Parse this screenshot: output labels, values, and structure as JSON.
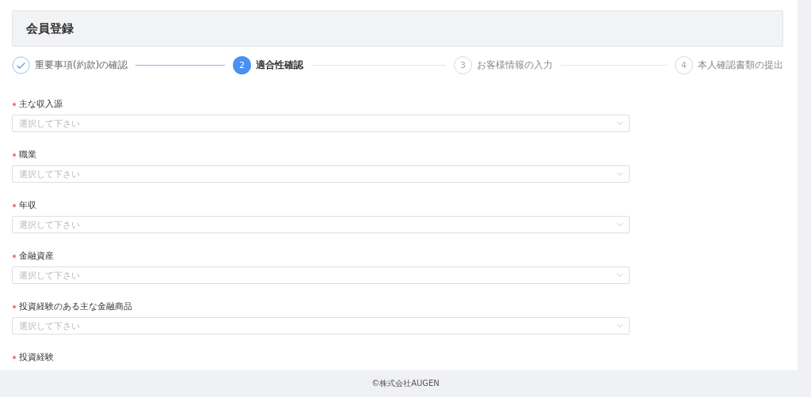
{
  "header": {
    "title": "会員登録"
  },
  "steps": [
    {
      "label": "重要事項(約款)の確認",
      "completed": true,
      "selected": false
    },
    {
      "number": "2",
      "label": "適合性確認",
      "completed": false,
      "selected": true
    },
    {
      "number": "3",
      "label": "お客様情報の入力",
      "completed": false,
      "selected": false
    },
    {
      "number": "4",
      "label": "本人確認書類の提出",
      "completed": false,
      "selected": false
    }
  ],
  "fields": [
    {
      "label": "主な収入源",
      "required": true,
      "placeholder": "選択して下さい"
    },
    {
      "label": "職業",
      "required": true,
      "placeholder": "選択して下さい"
    },
    {
      "label": "年収",
      "required": true,
      "placeholder": "選択して下さい"
    },
    {
      "label": "金融資産",
      "required": true,
      "placeholder": "選択して下さい"
    },
    {
      "label": "投資経験のある主な金融商品",
      "required": true,
      "placeholder": "選択して下さい"
    },
    {
      "label": "投資経験",
      "required": true
    }
  ],
  "footer": {
    "text": "©株式会社AUGEN"
  }
}
